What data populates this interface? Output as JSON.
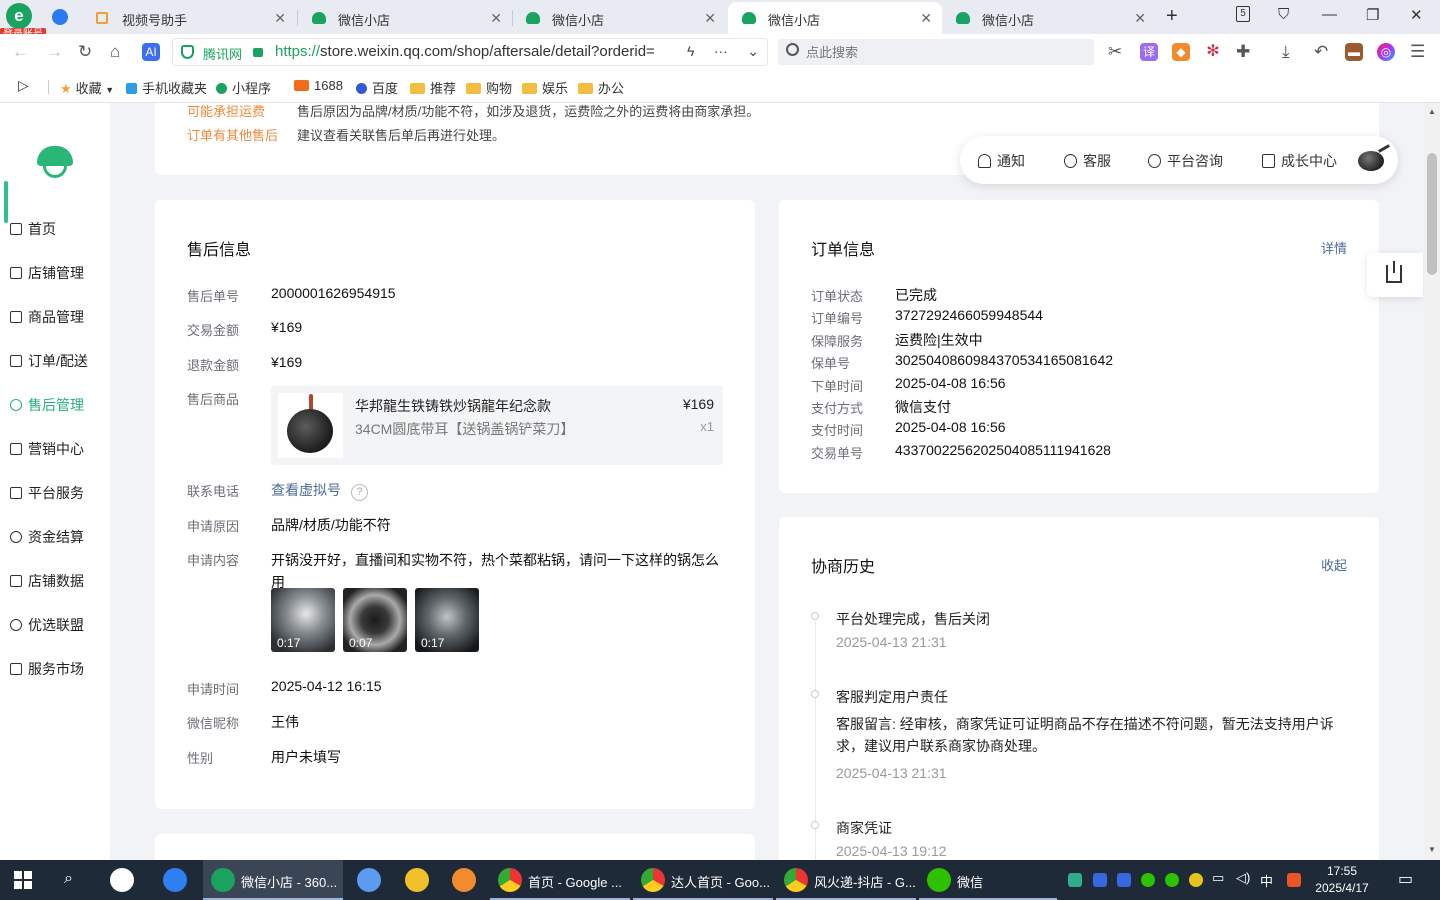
{
  "browser": {
    "login_badge": "登录账号",
    "tabs": [
      {
        "label": "视频号助手"
      },
      {
        "label": "微信小店"
      },
      {
        "label": "微信小店"
      },
      {
        "label": "微信小店"
      },
      {
        "label": "微信小店"
      }
    ],
    "tab_count": "5",
    "address": {
      "site_tag": "腾讯网",
      "protocol": "https://",
      "url_rest": "store.weixin.qq.com/shop/aftersale/detail?orderid="
    },
    "search_placeholder": "点此搜索",
    "bookmarks": [
      "收藏",
      "手机收藏夹",
      "小程序",
      "1688",
      "百度",
      "推荐",
      "购物",
      "娱乐",
      "办公"
    ]
  },
  "sidebar": {
    "items": [
      {
        "label": "首页"
      },
      {
        "label": "店铺管理"
      },
      {
        "label": "商品管理"
      },
      {
        "label": "订单/配送"
      },
      {
        "label": "售后管理"
      },
      {
        "label": "营销中心"
      },
      {
        "label": "平台服务"
      },
      {
        "label": "资金结算"
      },
      {
        "label": "店铺数据"
      },
      {
        "label": "优选联盟"
      },
      {
        "label": "服务市场"
      }
    ],
    "active_index": 4,
    "accent_color": "#26b07a"
  },
  "notice": {
    "rows": [
      {
        "key": "可能承担运费",
        "value": "售后原因为品牌/材质/功能不符，如涉及退货，运费险之外的运费将由商家承担。"
      },
      {
        "key": "订单有其他售后",
        "value": "建议查看关联售后单后再进行处理。"
      }
    ]
  },
  "float_bar": {
    "items": [
      "通知",
      "客服",
      "平台咨询",
      "成长中心"
    ]
  },
  "aftersale": {
    "title": "售后信息",
    "labels": {
      "no": "售后单号",
      "amount": "交易金额",
      "refund": "退款金额",
      "product": "售后商品",
      "phone": "联系电话",
      "reason": "申请原因",
      "content": "申请内容",
      "time": "申请时间",
      "nickname": "微信昵称",
      "gender": "性别"
    },
    "values": {
      "no": "2000001626954915",
      "amount": "¥169",
      "refund": "¥169",
      "phone_link": "查看虚拟号",
      "reason": "品牌/材质/功能不符",
      "content": "开锅没开好，直播间和实物不符，热个菜都粘锅，请问一下这样的锅怎么用",
      "time": "2025-04-12 16:15",
      "nickname": "王伟",
      "gender": "用户未填写"
    },
    "product": {
      "name": "华邦龍生铁铸铁炒锅龍年纪念款",
      "spec": "34CM圆底带耳【送锅盖锅铲菜刀】",
      "price": "¥169",
      "qty": "x1"
    },
    "media_durations": [
      "0:17",
      "0:07",
      "0:17"
    ]
  },
  "order": {
    "title": "订单信息",
    "link": "详情",
    "rows": [
      {
        "label": "订单状态",
        "value": "已完成"
      },
      {
        "label": "订单编号",
        "value": "3727292466059948544"
      },
      {
        "label": "保障服务",
        "value": "运费险|生效中"
      },
      {
        "label": "保单号",
        "value": "3025040860984370534165081642"
      },
      {
        "label": "下单时间",
        "value": "2025-04-08 16:56"
      },
      {
        "label": "支付方式",
        "value": "微信支付"
      },
      {
        "label": "支付时间",
        "value": "2025-04-08 16:56"
      },
      {
        "label": "交易单号",
        "value": "4337002256202504085111941628"
      }
    ]
  },
  "history": {
    "title": "协商历史",
    "link": "收起",
    "events": [
      {
        "title": "平台处理完成，售后关闭",
        "time": "2025-04-13 21:31"
      },
      {
        "title": "客服判定用户责任",
        "body": "客服留言: 经审核，商家凭证可证明商品不存在描述不符问题，暂无法支持用户诉求，建议用户联系商家协商处理。",
        "time": "2025-04-13 21:31"
      },
      {
        "title": "商家凭证",
        "time": "2025-04-13 19:12"
      }
    ]
  },
  "taskbar": {
    "apps": [
      {
        "label": "微信小店 - 360..."
      },
      {
        "label": "首页 - Google ..."
      },
      {
        "label": "达人首页 - Goo..."
      },
      {
        "label": "风火递-抖店 - G..."
      },
      {
        "label": "微信"
      }
    ],
    "ime": "中",
    "clock_time": "17:55",
    "clock_date": "2025/4/17"
  }
}
